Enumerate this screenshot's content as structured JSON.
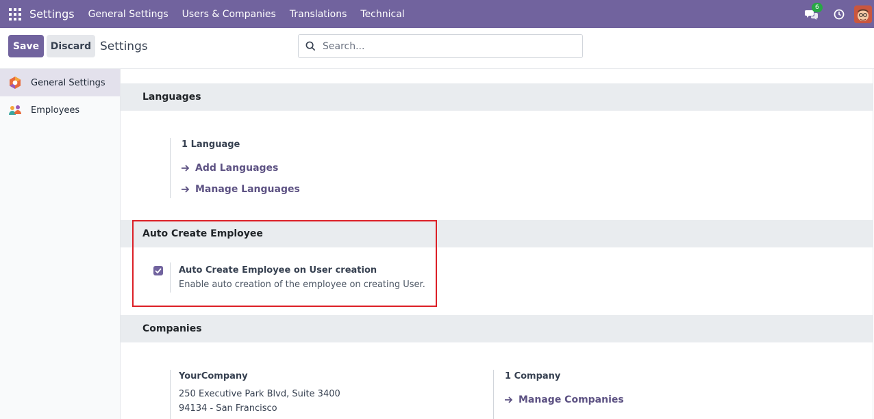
{
  "navbar": {
    "app_title": "Settings",
    "menu": [
      "General Settings",
      "Users & Companies",
      "Translations",
      "Technical"
    ],
    "chat_badge": "6",
    "bg_color": "#71639e"
  },
  "control": {
    "save_label": "Save",
    "discard_label": "Discard",
    "title": "Settings",
    "search_placeholder": "Search..."
  },
  "sidebar": {
    "items": [
      {
        "label": "General Settings",
        "icon": "general-settings-icon",
        "active": true
      },
      {
        "label": "Employees",
        "icon": "employees-icon",
        "active": false
      }
    ]
  },
  "languages": {
    "heading": "Languages",
    "count": "1 Language",
    "add_link": "Add Languages",
    "manage_link": "Manage Languages"
  },
  "auto_employee": {
    "heading": "Auto Create Employee",
    "checked": true,
    "option_title": "Auto Create Employee on User creation",
    "option_desc": "Enable auto creation of the employee on creating User."
  },
  "companies": {
    "heading": "Companies",
    "company_name": "YourCompany",
    "address_line1": "250 Executive Park Blvd, Suite 3400",
    "address_line2": "94134 - San Francisco",
    "count": "1 Company",
    "manage_link": "Manage Companies"
  },
  "colors": {
    "accent": "#71639e",
    "link": "#5d5283",
    "highlight_border": "#dc1f26",
    "badge": "#28a745"
  }
}
